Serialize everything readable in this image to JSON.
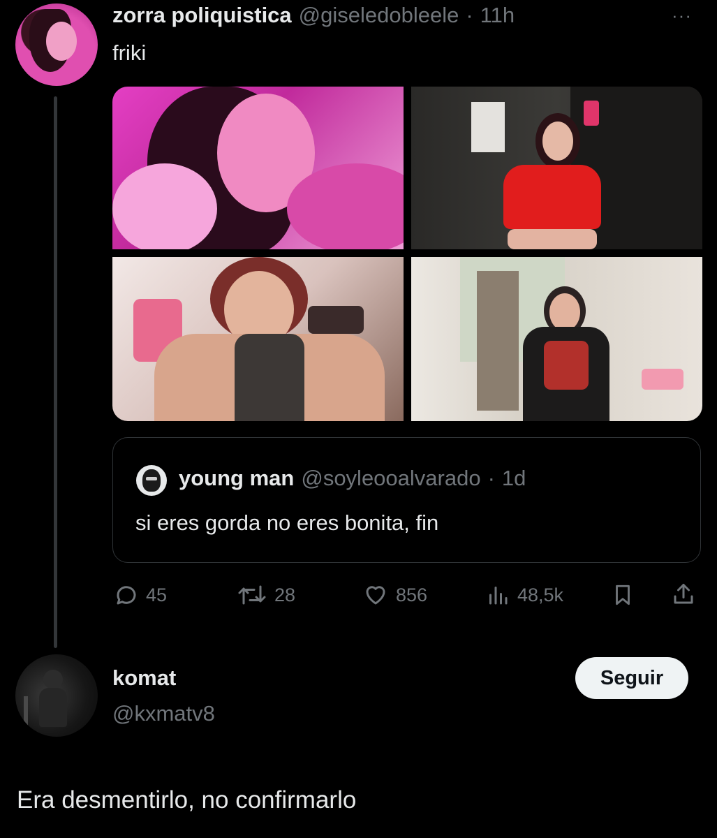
{
  "tweet": {
    "author_name": "zorra poliquistica",
    "author_handle": "@giseledobleele",
    "separator": "·",
    "time": "11h",
    "more_label": "···",
    "text": "friki"
  },
  "quoted": {
    "name": "young man",
    "handle": "@soyleooalvarado",
    "separator": "·",
    "time": "1d",
    "text": "si eres gorda no eres bonita, fin"
  },
  "actions": {
    "replies": "45",
    "retweets": "28",
    "likes": "856",
    "views": "48,5k"
  },
  "icons": {
    "reply": "speech-bubble-icon",
    "retweet": "retweet-icon",
    "like": "heart-icon",
    "views": "bar-chart-icon",
    "bookmark": "bookmark-icon",
    "share": "share-icon",
    "more": "more-dots-icon"
  },
  "reply_user": {
    "name": "komat",
    "handle": "@kxmatv8",
    "follow_label": "Seguir"
  },
  "reply_text": "Era desmentirlo, no confirmarlo",
  "colors": {
    "background": "#000000",
    "primary_text": "#e7e9ea",
    "secondary_text": "#71767b",
    "border": "#2f3336",
    "button_bg": "#eff3f4"
  }
}
